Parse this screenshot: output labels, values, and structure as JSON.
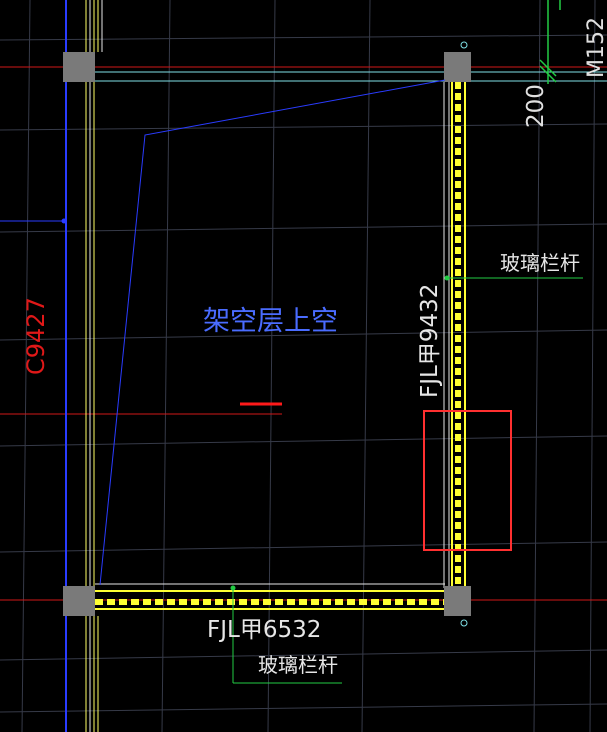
{
  "colors": {
    "background": "#000000",
    "grid": "#3a3d4a",
    "axis_red": "#e01818",
    "wall_yellow": "#ffff33",
    "wall_white": "#e6e6e6",
    "beam_cyan": "#7fe0e6",
    "outline_blue": "#2a3cff",
    "leader_green": "#22cc44",
    "column_gray": "#808080",
    "highlight_box": "#ff3030",
    "text_blue": "#4a6cff"
  },
  "labels": {
    "room_name": "架空层上空",
    "axis_tag": "C9427",
    "door_tag": "M152",
    "dimension": "200",
    "railing_right": "玻璃栏杆",
    "railing_bottom": "玻璃栏杆",
    "window_right": "FJL甲9432",
    "window_bottom": "FJL甲6532"
  }
}
